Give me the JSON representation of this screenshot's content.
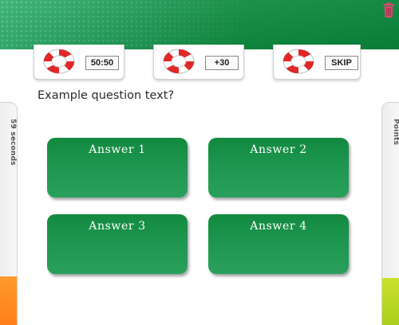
{
  "header": {
    "trash_icon": "trash-icon",
    "trash_color": "#d24a6a"
  },
  "lifelines": [
    {
      "id": "fifty",
      "label": "50:50",
      "icon": "lifebuoy-icon"
    },
    {
      "id": "time",
      "label": "+30",
      "icon": "lifebuoy-icon"
    },
    {
      "id": "skip",
      "label": "SKIP",
      "icon": "lifebuoy-icon"
    }
  ],
  "question": {
    "text": "Example question text?"
  },
  "timer": {
    "label": "59 seconds",
    "fill_color": "#ff8a22",
    "level_fraction": 0.25
  },
  "points": {
    "label": "Points",
    "fill_color": "#b5d422",
    "level_fraction": 0.24
  },
  "answers": [
    {
      "label": "Answer 1"
    },
    {
      "label": "Answer 2"
    },
    {
      "label": "Answer 3"
    },
    {
      "label": "Answer 4"
    }
  ],
  "colors": {
    "brand_green": "#0f8a3e",
    "answer_green": "#1d9650"
  }
}
